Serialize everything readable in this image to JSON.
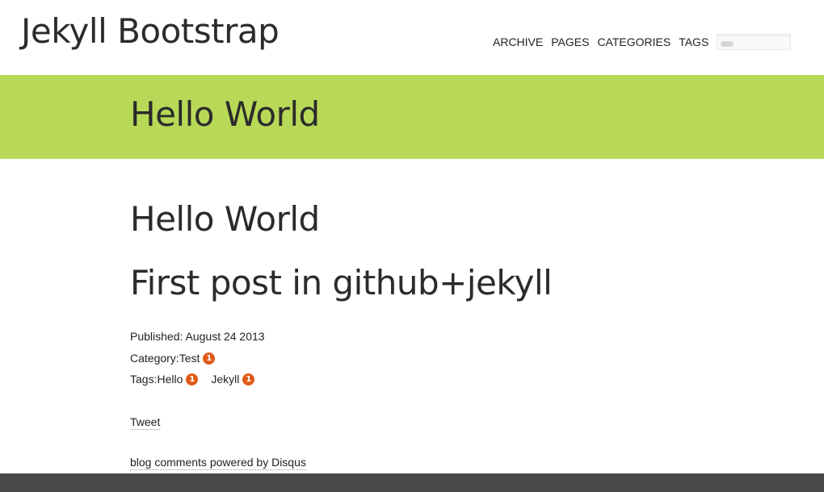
{
  "header": {
    "brand": "Jekyll Bootstrap",
    "nav": [
      "ARCHIVE",
      "PAGES",
      "CATEGORIES",
      "TAGS"
    ]
  },
  "banner": {
    "title": "Hello World"
  },
  "post": {
    "title": "Hello World",
    "subtitle": "First post in github+jekyll",
    "published": "Published: August 24 2013",
    "category_label": "Category:",
    "category_name": "Test",
    "category_count": "1",
    "tags_label": "Tags:",
    "tags": [
      {
        "name": "Hello",
        "count": "1"
      },
      {
        "name": "Jekyll",
        "count": "1"
      }
    ],
    "tweet": "Tweet",
    "disqus": "blog comments powered by Disqus"
  },
  "colors": {
    "banner": "#b8d957",
    "badge": "#e05a17",
    "footer": "#4a4a4a"
  }
}
